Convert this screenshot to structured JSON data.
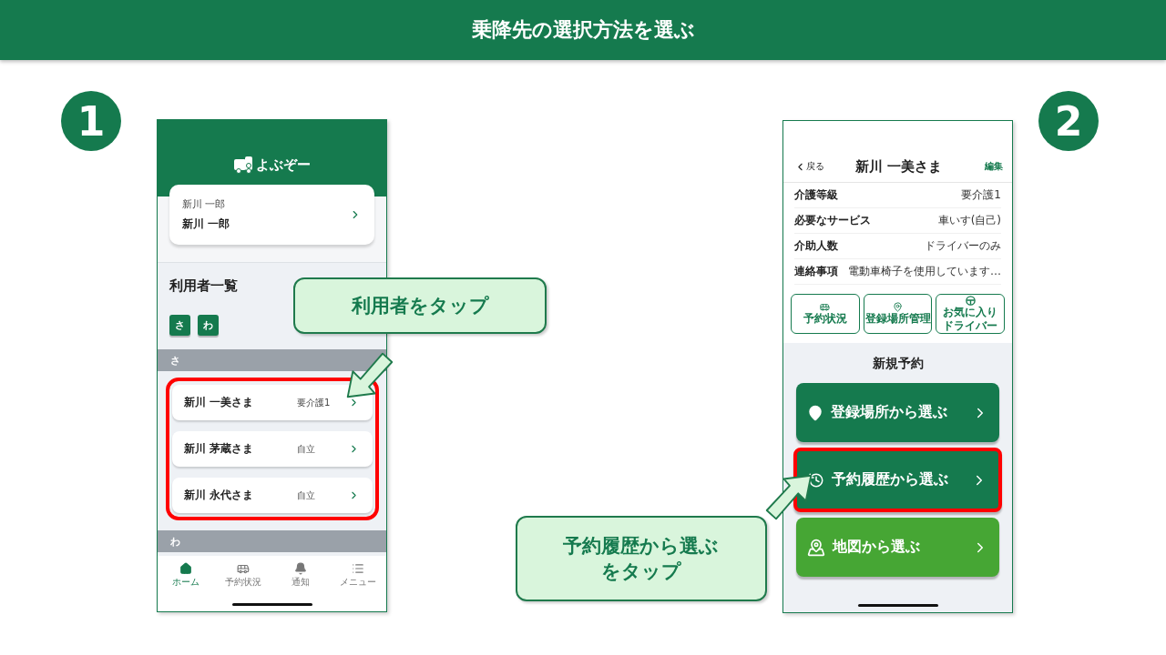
{
  "title": "乗降先の選択方法を選ぶ",
  "steps": [
    {
      "number": "1"
    },
    {
      "number": "2"
    }
  ],
  "phone_1": {
    "logo": "よぶぞー",
    "account": {
      "kana": "新川 一郎",
      "name": "新川 一郎"
    },
    "list_title": "利用者一覧",
    "index": [
      "さ",
      "わ"
    ],
    "sections": [
      {
        "label": "さ",
        "highlighted": true,
        "users": [
          {
            "name": "新川 一美さま",
            "grade": "要介護1"
          },
          {
            "name": "新川 茅蔵さま",
            "grade": "自立"
          },
          {
            "name": "新川 永代さま",
            "grade": "自立"
          }
        ]
      },
      {
        "label": "わ"
      }
    ],
    "tabs": [
      {
        "label": "ホーム",
        "selected": true,
        "kind": "home"
      },
      {
        "label": "予約状況",
        "selected": false,
        "kind": "car"
      },
      {
        "label": "通知",
        "selected": false,
        "kind": "bell"
      },
      {
        "label": "メニュー",
        "selected": false,
        "kind": "menu"
      }
    ]
  },
  "phone_2": {
    "back": "戻る",
    "title": "新川 一美さま",
    "edit": "編集",
    "details": [
      {
        "label": "介護等級",
        "value": "要介護1"
      },
      {
        "label": "必要なサービス",
        "value": "車いす(自己)"
      },
      {
        "label": "介助人数",
        "value": "ドライバーのみ"
      },
      {
        "label": "連絡事項",
        "value": "電動車椅子を使用しています…"
      }
    ],
    "shortcuts": [
      {
        "kind": "car",
        "lines": [
          "予約状況"
        ]
      },
      {
        "kind": "pin",
        "lines": [
          "登録場所管理"
        ]
      },
      {
        "kind": "wheel",
        "lines": [
          "お気に入り",
          "ドライバー"
        ]
      }
    ],
    "new_booking": "新規予約",
    "options": [
      {
        "kind": "pin",
        "label": "登録場所から選ぶ",
        "color": "#157a4e",
        "highlighted": false
      },
      {
        "kind": "history",
        "label": "予約履歴から選ぶ",
        "color": "#157a4e",
        "highlighted": true
      },
      {
        "kind": "map",
        "label": "地図から選ぶ",
        "color": "#46a634",
        "highlighted": false
      }
    ]
  },
  "callouts": [
    "利用者をタップ",
    "予約履歴から選ぶをタップ"
  ]
}
